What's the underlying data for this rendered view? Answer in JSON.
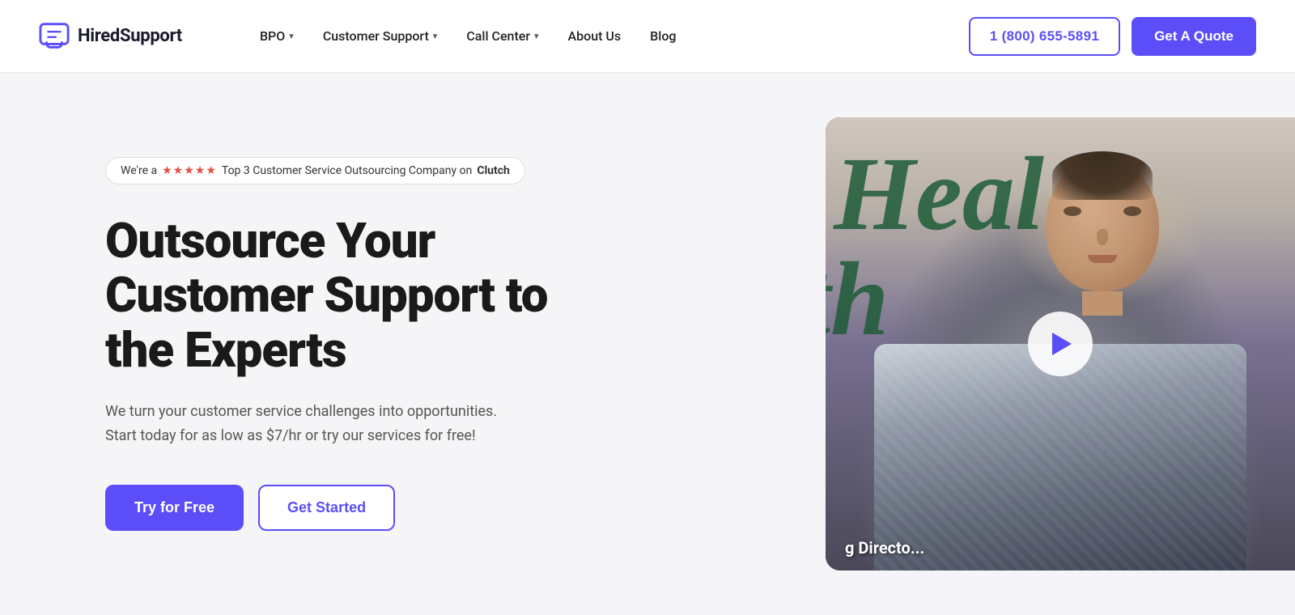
{
  "brand": {
    "name": "HiredSupport",
    "logo_alt": "HiredSupport logo"
  },
  "navbar": {
    "links": [
      {
        "id": "bpo",
        "label": "BPO",
        "has_dropdown": true
      },
      {
        "id": "customer-support",
        "label": "Customer Support",
        "has_dropdown": true
      },
      {
        "id": "call-center",
        "label": "Call Center",
        "has_dropdown": true
      },
      {
        "id": "about-us",
        "label": "About Us",
        "has_dropdown": false
      },
      {
        "id": "blog",
        "label": "Blog",
        "has_dropdown": false
      }
    ],
    "phone": "1 (800) 655-5891",
    "cta": "Get A Quote"
  },
  "hero": {
    "badge": {
      "prefix": "We're a",
      "stars": "★★★★★",
      "suffix_plain": "Top 3 Customer Service Outsourcing Company on",
      "suffix_bold": "Clutch"
    },
    "title": "Outsource Your Customer Support to the Experts",
    "subtitle": "We turn your customer service challenges into opportunities. Start today for as low as $7/hr or try our services for free!",
    "btn_try": "Try for Free",
    "btn_started": "Get Started"
  },
  "video": {
    "bg_text1": "Heal",
    "bg_text2": "th",
    "bottom_text": "g Directo...",
    "play_label": "Play video"
  }
}
